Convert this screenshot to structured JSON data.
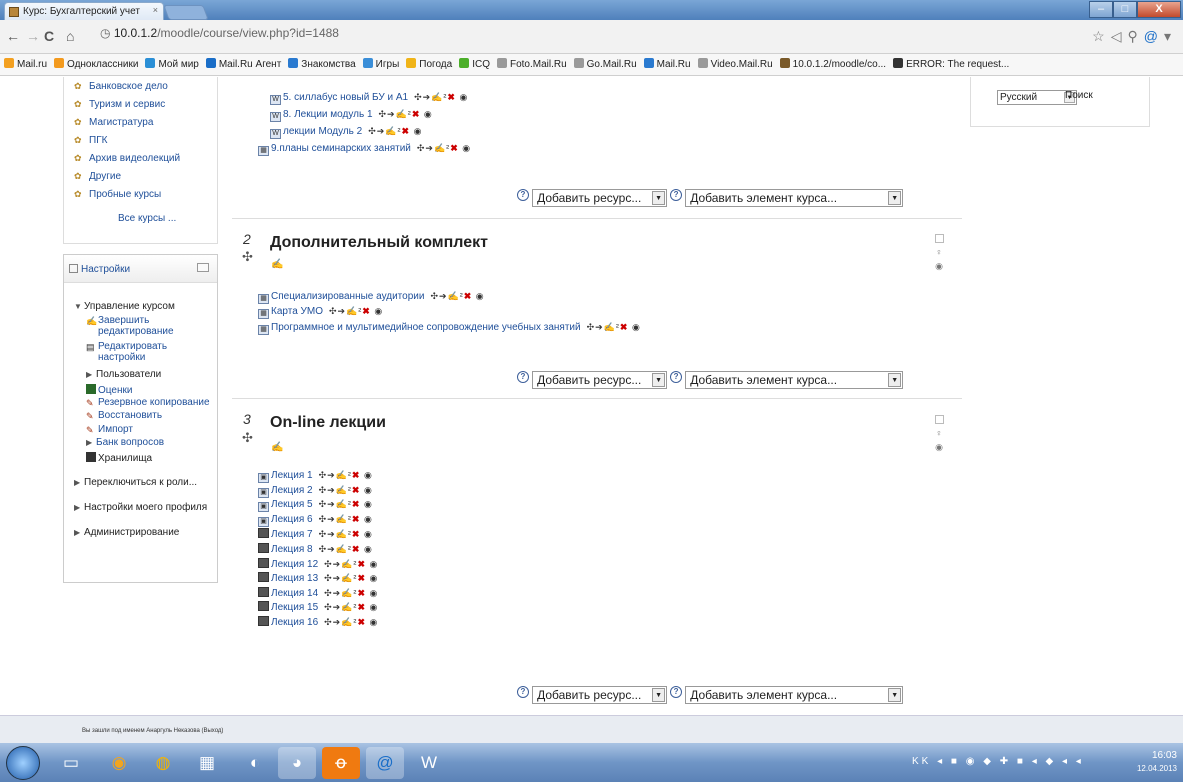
{
  "browser": {
    "tab_title": "Курс: Бухгалтерский учет",
    "tab_close": "×",
    "url_host": "10.0.1.2",
    "url_path": "/moodle/course/view.php?id=1488",
    "window_buttons": {
      "minimize": "–",
      "maximize": "□",
      "close": "X"
    },
    "bookmarks": [
      {
        "label": "Mail.ru",
        "color": "#f3a020"
      },
      {
        "label": "Одноклассники",
        "color": "#f39a1e"
      },
      {
        "label": "Мой мир",
        "color": "#2a8fd6"
      },
      {
        "label": "Mail.Ru Агент",
        "color": "#1a6ec8"
      },
      {
        "label": "Знакомства",
        "color": "#2a7ad0"
      },
      {
        "label": "Игры",
        "color": "#3a8ed8"
      },
      {
        "label": "Погода",
        "color": "#f0b418"
      },
      {
        "label": "ICQ",
        "color": "#4caf2a"
      },
      {
        "label": "Foto.Mail.Ru",
        "color": "#9a9a9a"
      },
      {
        "label": "Go.Mail.Ru",
        "color": "#9a9a9a"
      },
      {
        "label": "Mail.Ru",
        "color": "#2a7ad0"
      },
      {
        "label": "Video.Mail.Ru",
        "color": "#9a9a9a"
      },
      {
        "label": "10.0.1.2/moodle/co...",
        "color": "#7a5a2a"
      },
      {
        "label": "ERROR: The request...",
        "color": "#333333"
      }
    ]
  },
  "sidebar": {
    "courses": [
      "Банковское дело",
      "Туризм и сервис",
      "Магистратура",
      "ПГК",
      "Архив видеолекций",
      "Другие",
      "Пробные курсы"
    ],
    "all_courses": "Все курсы ...",
    "settings": {
      "title": "Настройки",
      "course_admin": "Управление курсом",
      "items": [
        {
          "label": "Завершить редактирование"
        },
        {
          "label": "Редактировать настройки"
        },
        {
          "label": "Пользователи"
        },
        {
          "label": "Оценки"
        },
        {
          "label": "Резервное копирование"
        },
        {
          "label": "Восстановить"
        },
        {
          "label": "Импорт"
        },
        {
          "label": "Банк вопросов"
        },
        {
          "label": "Хранилища"
        }
      ],
      "switch_role": "Переключиться к роли...",
      "profile": "Настройки моего профиля",
      "admin": "Администрирование"
    }
  },
  "main": {
    "action_icons": "✣➔✍²",
    "delete_icon": "✖",
    "eye_icon": "◉",
    "section1_resources": [
      "5. силлабус новый БУ и А1",
      "8. Лекции модуль 1",
      "лекции Модуль 2",
      "9.планы семинарских занятий"
    ],
    "add_resource": "Добавить ресурс...",
    "add_activity": "Добавить элемент курса...",
    "help": "?",
    "sections": [
      {
        "number": "2",
        "title": "Дополнительный комплект",
        "resources": [
          "Специализированные аудитории",
          "Карта УМО",
          "Программное и мультимедийное сопровождение учебных занятий"
        ]
      },
      {
        "number": "3",
        "title": "On-line лекции",
        "resources": [
          "Лекция 1",
          "Лекция 2",
          "Лекция 5",
          "Лекция 6",
          "Лекция 7",
          "Лекция 8",
          "Лекция 12",
          "Лекция 13",
          "Лекция 14",
          "Лекция 15",
          "Лекция 16"
        ]
      }
    ]
  },
  "language": {
    "selected": "Русский",
    "search_button": "Поиск"
  },
  "footer": {
    "logged_in": "Вы зашли под именем Анаргуль Неказова (Выход)"
  },
  "taskbar": {
    "tray_lang": "KK",
    "time": "16:03",
    "date": "12.04.2013"
  }
}
